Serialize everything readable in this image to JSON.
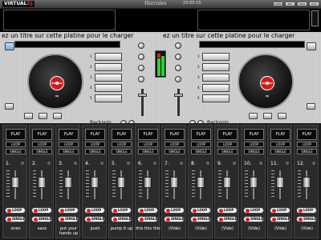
{
  "app": {
    "logo_prefix": "VIRTUAL",
    "logo_suffix": "DJ",
    "brand": "Hercules",
    "clock": "23:05:15"
  },
  "window_buttons": [
    "CONFIG",
    "REC",
    "HELP",
    "EXIT"
  ],
  "decks": [
    {
      "title": "ez un titre sur cette platine pour le charger",
      "platter_label": "VIRTUAL DJ",
      "backspin_label": "Backspin"
    },
    {
      "title": "ez un titre sur cette platine pour le charger",
      "platter_label": "VIRTUAL DJ",
      "backspin_label": "Backspin"
    }
  ],
  "cues": [
    "1",
    "2",
    "3",
    "4",
    "5"
  ],
  "sampler": {
    "play_label": "PLAY",
    "loop_label": "LOOP",
    "single_label": "SINGLE",
    "columns": [
      {
        "n": "1.",
        "name": "siren"
      },
      {
        "n": "2.",
        "name": "saxo"
      },
      {
        "n": "3.",
        "name": "put your hands up"
      },
      {
        "n": "4.",
        "name": "push"
      },
      {
        "n": "5.",
        "name": "pump it up"
      },
      {
        "n": "6.",
        "name": "this this this"
      },
      {
        "n": "7.",
        "name": "(Vide)"
      },
      {
        "n": "8.",
        "name": "(Vide)"
      },
      {
        "n": "9.",
        "name": "(Vide)"
      },
      {
        "n": "10.",
        "name": "(Vide)"
      },
      {
        "n": "11.",
        "name": "(Vide)"
      },
      {
        "n": "12.",
        "name": "(Vide)"
      }
    ]
  },
  "colors": {
    "accent": "#d41b1b",
    "panel": "#c9c9c9",
    "bank": "#1c1c1c"
  }
}
